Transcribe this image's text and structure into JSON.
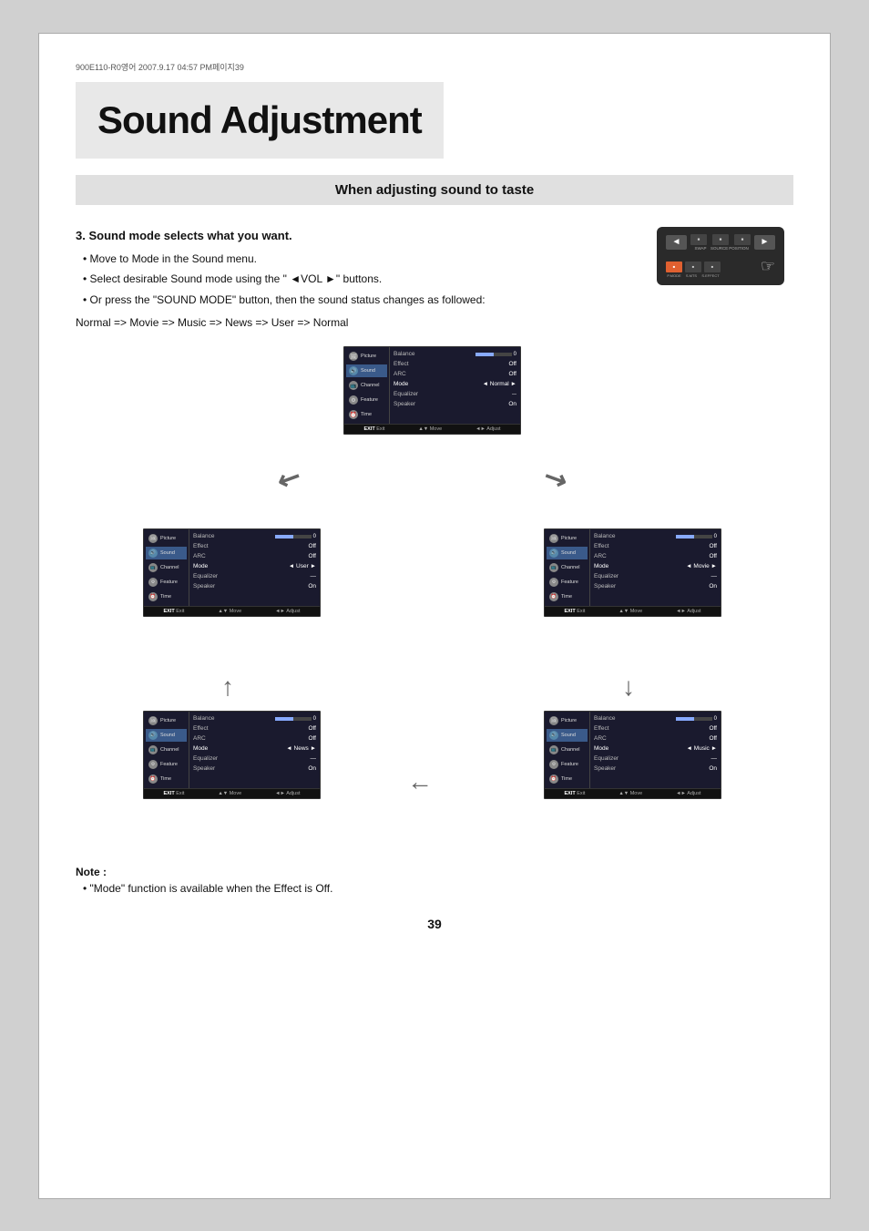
{
  "meta": {
    "header": "900E110-R0영어  2007.9.17 04:57 PM페이지39"
  },
  "title": "Sound Adjustment",
  "section_header": "When adjusting sound to taste",
  "step": {
    "number": "3.",
    "title": "Sound mode selects what you want.",
    "bullets": [
      "Move to Mode in the Sound menu.",
      "Select desirable Sound mode using the \" ◄VOL ►\" buttons.",
      "Or press the \"SOUND MODE\" button, then the sound status changes as followed:"
    ],
    "normal_line": "Normal => Movie  => Music => News => User  => Normal"
  },
  "note": {
    "title": "Note :",
    "text": "\"Mode\" function is available when the Effect is Off."
  },
  "page_number": "39",
  "remote": {
    "top_buttons": [
      "◄",
      "►"
    ],
    "labels": [
      "SWAP",
      "SOURCE",
      "POSITION"
    ],
    "bottom_buttons": [
      "P.MODE",
      "S.MTS",
      "S.EFFECT"
    ],
    "hand": "☞"
  },
  "diagrams": [
    {
      "id": "center",
      "mode": "Normal",
      "balance_val": "0",
      "effect": "Off",
      "arc": "Off",
      "speaker": "On"
    },
    {
      "id": "bottom-left",
      "mode": "User",
      "balance_val": "0",
      "effect": "Off",
      "arc": "Off",
      "speaker": "On"
    },
    {
      "id": "bottom-right",
      "mode": "Movie",
      "balance_val": "0",
      "effect": "Off",
      "arc": "Off",
      "speaker": "On"
    },
    {
      "id": "btm2-left",
      "mode": "News",
      "balance_val": "0",
      "effect": "Off",
      "arc": "Off",
      "speaker": "On"
    },
    {
      "id": "btm2-right",
      "mode": "Music",
      "balance_val": "0",
      "effect": "Off",
      "arc": "Off",
      "speaker": "On"
    }
  ],
  "menu_items": [
    "Picture",
    "Sound",
    "Channel",
    "Feature",
    "Time"
  ],
  "menu_fields": [
    "Balance",
    "Effect",
    "ARC",
    "Mode",
    "Equalizer",
    "Speaker"
  ],
  "footer_labels": [
    "Exit",
    "▲▼ Move",
    "◄► Adjust"
  ]
}
